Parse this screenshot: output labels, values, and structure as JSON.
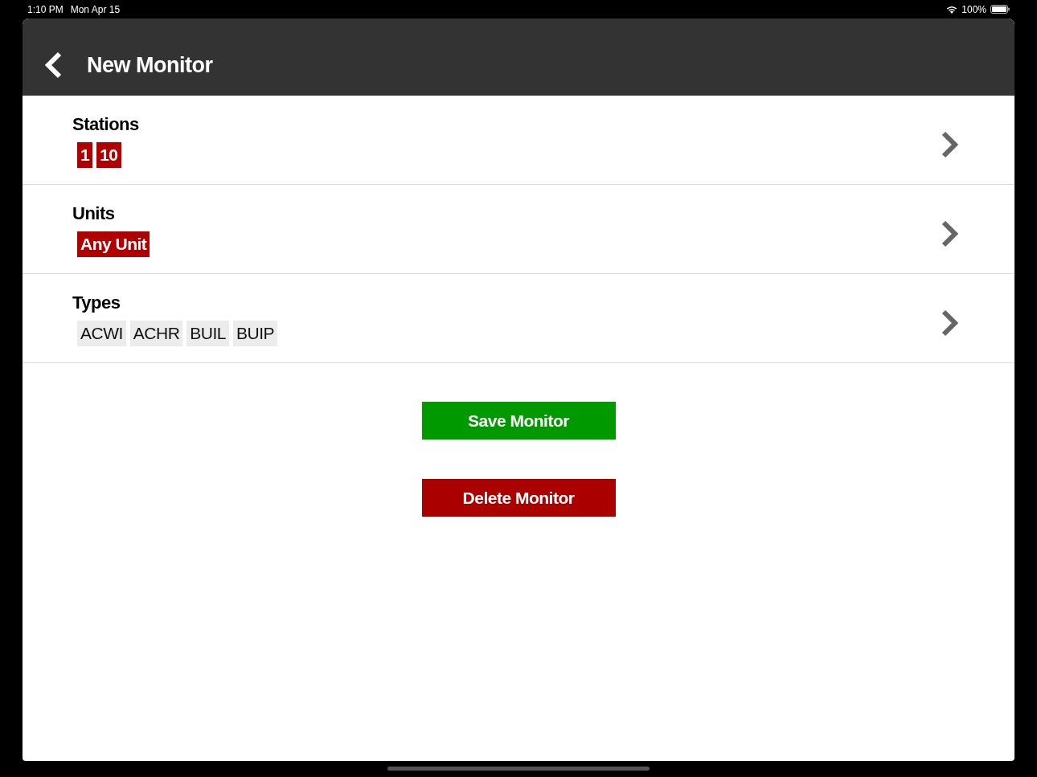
{
  "status_bar": {
    "time": "1:10 PM",
    "date": "Mon Apr 15",
    "battery": "100%"
  },
  "header": {
    "title": "New Monitor"
  },
  "sections": [
    {
      "label": "Stations",
      "kind": "highlighted",
      "tags": [
        "1",
        "10"
      ]
    },
    {
      "label": "Units",
      "kind": "highlighted",
      "tags": [
        "Any Unit"
      ]
    },
    {
      "label": "Types",
      "kind": "plain",
      "tags": [
        "ACWI",
        "ACHR",
        "BUIL",
        "BUIP"
      ]
    }
  ],
  "buttons": [
    {
      "label": "Save Monitor",
      "kind": "save"
    },
    {
      "label": "Delete Monitor",
      "kind": "delete"
    }
  ]
}
